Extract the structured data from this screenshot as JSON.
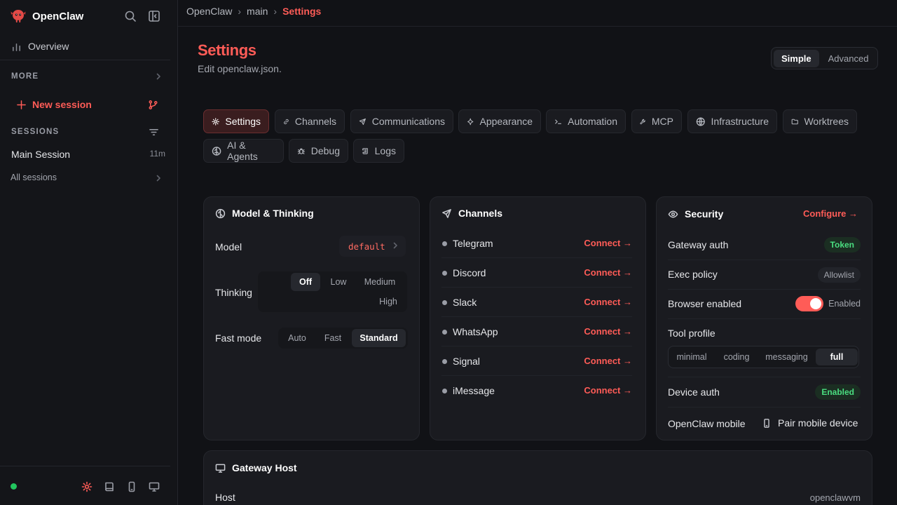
{
  "app": {
    "name": "OpenClaw",
    "brand_color": "#ff5c57"
  },
  "sidebar": {
    "overview_label": "Overview",
    "more_label": "MORE",
    "new_session_label": "New session",
    "sessions_label": "SESSIONS",
    "sessions": [
      {
        "name": "Main Session",
        "age": "11m"
      }
    ],
    "all_sessions_label": "All sessions",
    "status": "online"
  },
  "breadcrumb": {
    "items": [
      "OpenClaw",
      "main",
      "Settings"
    ]
  },
  "header": {
    "title": "Settings",
    "subtitle": "Edit openclaw.json.",
    "mode": {
      "options": [
        "Simple",
        "Advanced"
      ],
      "selected": "Simple"
    }
  },
  "tabs": [
    {
      "label": "Settings",
      "icon": "gear-icon",
      "active": true
    },
    {
      "label": "Channels",
      "icon": "link-icon",
      "active": false
    },
    {
      "label": "Communications",
      "icon": "send-icon",
      "active": false
    },
    {
      "label": "Appearance",
      "icon": "sparkle-icon",
      "active": false
    },
    {
      "label": "Automation",
      "icon": "terminal-icon",
      "active": false
    },
    {
      "label": "MCP",
      "icon": "wrench-icon",
      "active": false
    },
    {
      "label": "Infrastructure",
      "icon": "globe-icon",
      "active": false
    },
    {
      "label": "Worktrees",
      "icon": "folder-icon",
      "active": false
    },
    {
      "label": "AI & Agents",
      "icon": "brain-icon",
      "active": false
    },
    {
      "label": "Debug",
      "icon": "bug-icon",
      "active": false
    },
    {
      "label": "Logs",
      "icon": "scroll-icon",
      "active": false
    }
  ],
  "model_card": {
    "title": "Model & Thinking",
    "model_label": "Model",
    "model_value": "default",
    "thinking_label": "Thinking",
    "thinking_options": [
      "Off",
      "Low",
      "Medium",
      "High"
    ],
    "thinking_selected": "Off",
    "fast_mode_label": "Fast mode",
    "fast_mode_options": [
      "Auto",
      "Fast",
      "Standard"
    ],
    "fast_mode_selected": "Standard"
  },
  "channels_card": {
    "title": "Channels",
    "connect_label": "Connect →",
    "items": [
      "Telegram",
      "Discord",
      "Slack",
      "WhatsApp",
      "Signal",
      "iMessage"
    ]
  },
  "security_card": {
    "title": "Security",
    "configure_label": "Configure →",
    "gateway_auth_label": "Gateway auth",
    "gateway_auth_value": "Token",
    "exec_policy_label": "Exec policy",
    "exec_policy_value": "Allowlist",
    "browser_label": "Browser enabled",
    "browser_value": "Enabled",
    "browser_on": true,
    "tool_profile_label": "Tool profile",
    "tool_profile_options": [
      "minimal",
      "coding",
      "messaging",
      "full"
    ],
    "tool_profile_selected": "full",
    "device_auth_label": "Device auth",
    "device_auth_value": "Enabled",
    "mobile_label": "OpenClaw mobile",
    "pair_label": "Pair mobile device"
  },
  "gateway_card": {
    "title": "Gateway Host",
    "host_label": "Host",
    "host_value": "openclawvm"
  }
}
